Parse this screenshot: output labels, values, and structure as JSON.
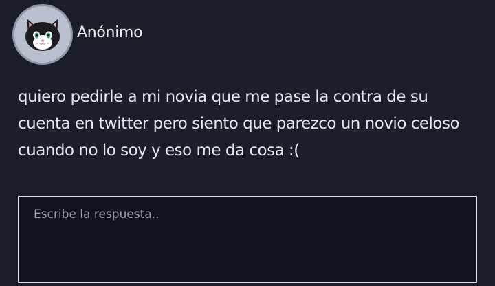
{
  "question": {
    "author": "Anónimo",
    "avatar_icon": "cat-avatar-icon",
    "text": "quiero pedirle a mi novia que me pase la contra de su cuenta en twitter pero siento que parezco un novio celoso cuando no lo soy y eso me da cosa :("
  },
  "answer": {
    "placeholder": "Escribe la respuesta..",
    "value": ""
  },
  "colors": {
    "background": "#1b1f2a",
    "input_background": "#101420",
    "input_border": "#d8dce4",
    "text": "#e4e7ee"
  }
}
